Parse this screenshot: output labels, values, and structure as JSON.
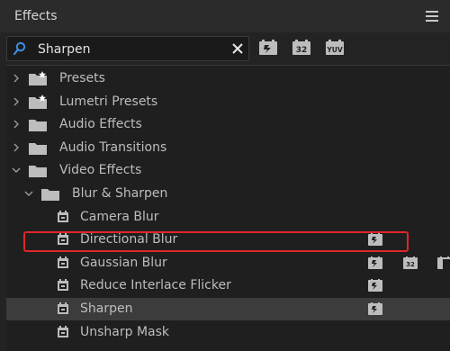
{
  "panel": {
    "title": "Effects"
  },
  "search": {
    "value": "Sharpen"
  },
  "filters": {
    "thirty_two": "32",
    "yuv": "YUV"
  },
  "tree": [
    {
      "label": "Presets",
      "indent": 0,
      "expanded": false,
      "kind": "folder-star"
    },
    {
      "label": "Lumetri Presets",
      "indent": 0,
      "expanded": false,
      "kind": "folder-star"
    },
    {
      "label": "Audio Effects",
      "indent": 0,
      "expanded": false,
      "kind": "folder"
    },
    {
      "label": "Audio Transitions",
      "indent": 0,
      "expanded": false,
      "kind": "folder"
    },
    {
      "label": "Video Effects",
      "indent": 0,
      "expanded": true,
      "kind": "folder"
    },
    {
      "label": "Blur & Sharpen",
      "indent": 1,
      "expanded": true,
      "kind": "folder"
    },
    {
      "label": "Camera Blur",
      "indent": 2,
      "kind": "effect",
      "badges": []
    },
    {
      "label": "Directional Blur",
      "indent": 2,
      "kind": "effect",
      "badges": [
        "accel"
      ]
    },
    {
      "label": "Gaussian Blur",
      "indent": 2,
      "kind": "effect",
      "badges": [
        "accel",
        "32",
        "yuv"
      ]
    },
    {
      "label": "Reduce Interlace Flicker",
      "indent": 2,
      "kind": "effect",
      "badges": [
        "accel"
      ]
    },
    {
      "label": "Sharpen",
      "indent": 2,
      "kind": "effect",
      "badges": [
        "accel"
      ],
      "selected": true
    },
    {
      "label": "Unsharp Mask",
      "indent": 2,
      "kind": "effect",
      "badges": []
    }
  ],
  "colors": {
    "highlight": "#e0262a",
    "panel_bg": "#232323",
    "list_bg": "#1f1f1f"
  }
}
